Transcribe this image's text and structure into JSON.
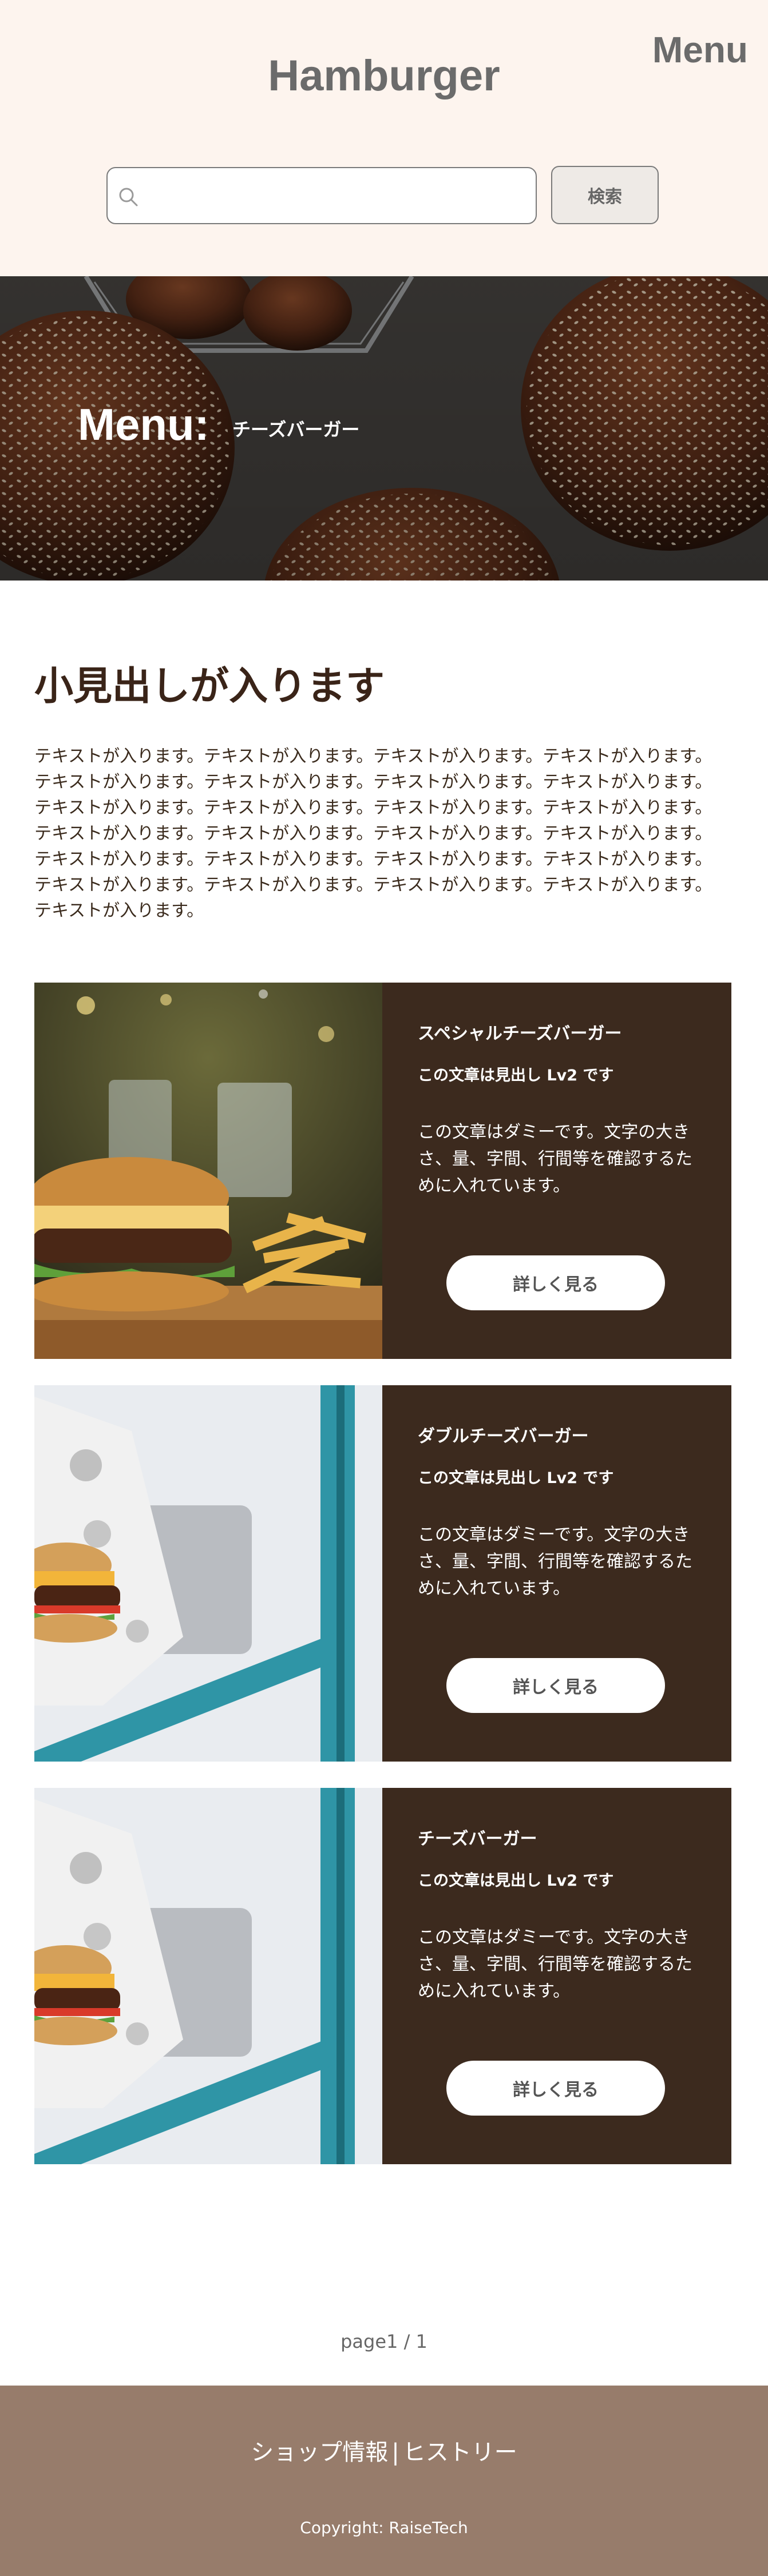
{
  "header": {
    "site_title": "Hamburger",
    "menu_label": "Menu",
    "search": {
      "placeholder": "",
      "value": "",
      "button_label": "検索"
    }
  },
  "hero": {
    "title": "Menu:",
    "subtitle": "チーズバーガー"
  },
  "intro": {
    "heading": "小見出しが入ります",
    "text": "テキストが入ります。テキストが入ります。テキストが入ります。テキストが入ります。 テキストが入ります。テキストが入ります。テキストが入ります。テキストが入ります。 テキストが入ります。テキストが入ります。テキストが入ります。テキストが入ります。 テキストが入ります。テキストが入ります。テキストが入ります。テキストが入ります。 テキストが入ります。テキストが入ります。テキストが入ります。テキストが入ります。 テキストが入ります。テキストが入ります。テキストが入ります。テキストが入ります。 テキストが入ります。"
  },
  "cards": [
    {
      "name": "スペシャルチーズバーガー",
      "subheading": "この文章は見出し Lv2 です",
      "description": "この文章はダミーです。文字の大きさ、量、字間、行間等を確認するために入れています。",
      "button_label": "詳しく見る"
    },
    {
      "name": "ダブルチーズバーガー",
      "subheading": "この文章は見出し Lv2 です",
      "description": "この文章はダミーです。文字の大きさ、量、字間、行間等を確認するために入れています。",
      "button_label": "詳しく見る"
    },
    {
      "name": "チーズバーガー",
      "subheading": "この文章は見出し Lv2 です",
      "description": "この文章はダミーです。文字の大きさ、量、字間、行間等を確認するために入れています。",
      "button_label": "詳しく見る"
    }
  ],
  "pagination": {
    "text": "page1 / 1"
  },
  "footer": {
    "link_shop": "ショップ情報",
    "separator": "|",
    "link_history": "ヒストリー",
    "copyright": "Copyright: RaiseTech"
  },
  "icons": {
    "search": "search-icon"
  },
  "colors": {
    "header_bg": "#fdf4ee",
    "card_bg": "#3c2a1e",
    "footer_bg": "#977c6b",
    "title_gray": "#6b6b6b"
  }
}
